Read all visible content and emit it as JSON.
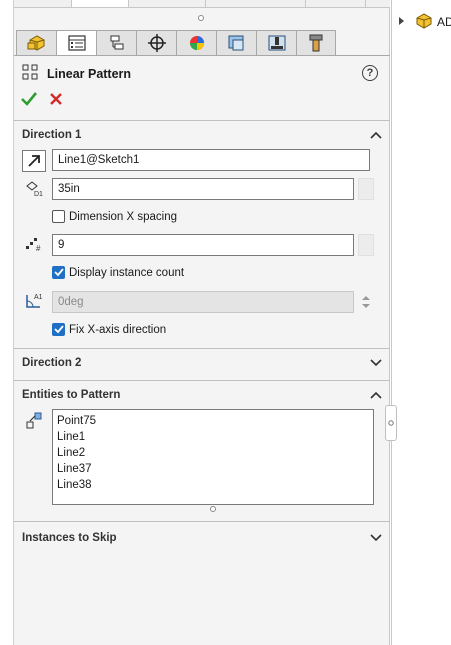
{
  "feature": {
    "title": "Linear Pattern",
    "help_label": "?"
  },
  "tool_tabs": [
    {
      "icon": "feature-manager-icon"
    },
    {
      "icon": "property-manager-icon"
    },
    {
      "icon": "configuration-manager-icon"
    },
    {
      "icon": "dimxpert-icon"
    },
    {
      "icon": "display-manager-icon"
    },
    {
      "icon": "cam-feature-icon"
    },
    {
      "icon": "cam-operation-icon"
    },
    {
      "icon": "cam-tool-icon"
    }
  ],
  "direction1": {
    "title": "Direction 1",
    "reference": "Line1@Sketch1",
    "spacing": "35in",
    "dimension_x_spacing_label": "Dimension X spacing",
    "dimension_x_spacing_checked": false,
    "instance_count": "9",
    "display_instance_count_label": "Display instance count",
    "display_instance_count_checked": true,
    "angle": "0deg",
    "fix_x_axis_label": "Fix X-axis direction",
    "fix_x_axis_checked": true
  },
  "direction2": {
    "title": "Direction 2"
  },
  "entities": {
    "title": "Entities to Pattern",
    "items": [
      "Point75",
      "Line1",
      "Line2",
      "Line37",
      "Line38"
    ]
  },
  "instances_to_skip": {
    "title": "Instances to Skip"
  },
  "tree": {
    "root_label": "AD"
  },
  "colors": {
    "accent": "#1f6fc4",
    "ok": "#2e9e2e",
    "cancel": "#d42a2a"
  }
}
